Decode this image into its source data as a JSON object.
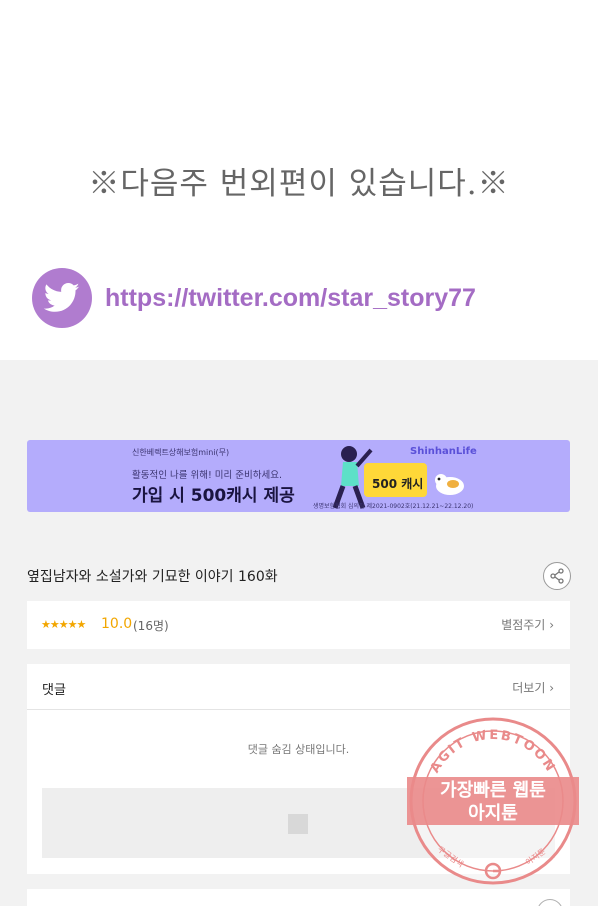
{
  "notice": {
    "text": "※다음주 번외편이 있습니다.※"
  },
  "twitter": {
    "icon": "twitter-bird-icon",
    "url": "https://twitter.com/star_story77",
    "color": "#b07ccf"
  },
  "ad_banner": {
    "small_text": "신한베렉트상해보험mini(무)",
    "sub_text": "활동적인 나를 위해! 미리 준비하세요.",
    "main_text": "가입 시 500캐시 제공",
    "brand": "ShinhanLife",
    "cash_badge": "500 캐시",
    "fine_print": "생명보험협회 심의필 제2021-0902호(21.12.21~22.12.20)",
    "bg_color": "#b4acfc"
  },
  "episode": {
    "title": "옆집남자와 소설가와 기묘한 이야기 160화",
    "share_icon": "share-icon"
  },
  "rating": {
    "stars": "★★★★★",
    "score": "10.0",
    "count": "(16명)",
    "rate_link": "별점주기",
    "accent_color": "#f2a600"
  },
  "comments": {
    "title": "댓글",
    "more_link": "더보기",
    "hidden_message": "댓글 숨김 상태입니다."
  },
  "watermark": {
    "top_text": "AGIT WEBTOON",
    "line1": "가장빠른 웹툰",
    "line2": "아지툰",
    "bottom_left": "구글검색",
    "bottom_right": "아지툰",
    "color": "#e36a6a"
  }
}
